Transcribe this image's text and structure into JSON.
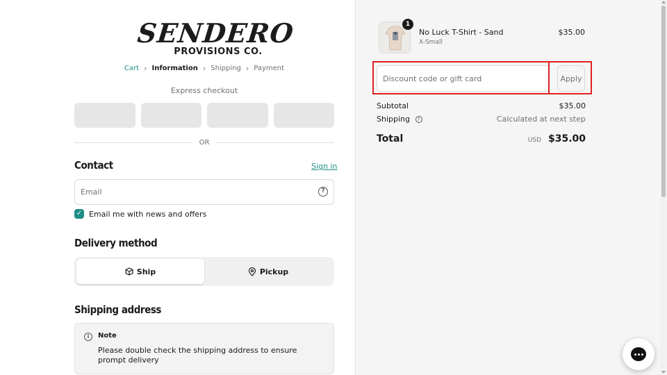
{
  "brand": {
    "logo_main": "SENDERO",
    "logo_sub": "PROVISIONS CO."
  },
  "breadcrumb": {
    "items": [
      {
        "label": "Cart"
      },
      {
        "label": "Information"
      },
      {
        "label": "Shipping"
      },
      {
        "label": "Payment"
      }
    ]
  },
  "express": {
    "label": "Express checkout",
    "or_text": "OR"
  },
  "contact": {
    "title": "Contact",
    "signin_label": "Sign in",
    "email_placeholder": "Email",
    "newsletter_label": "Email me with news and offers",
    "newsletter_checked": true
  },
  "delivery": {
    "title": "Delivery method",
    "options": [
      {
        "label": "Ship",
        "icon": "box-icon",
        "selected": true
      },
      {
        "label": "Pickup",
        "icon": "location-pin-icon",
        "selected": false
      }
    ]
  },
  "shipping_address": {
    "title": "Shipping address",
    "note_title": "Note",
    "note_text": "Please double check the shipping address to ensure prompt delivery"
  },
  "order": {
    "product": {
      "name": "No Luck T-Shirt - Sand",
      "variant": "X-Small",
      "price": "$35.00",
      "quantity": "1"
    },
    "discount_placeholder": "Discount code or gift card",
    "apply_label": "Apply",
    "subtotal_label": "Subtotal",
    "subtotal_value": "$35.00",
    "shipping_label": "Shipping",
    "shipping_value": "Calculated at next step",
    "total_label": "Total",
    "currency": "USD",
    "total_value": "$35.00"
  },
  "colors": {
    "accent": "#1f8d87",
    "highlight_frame": "#e02020"
  }
}
